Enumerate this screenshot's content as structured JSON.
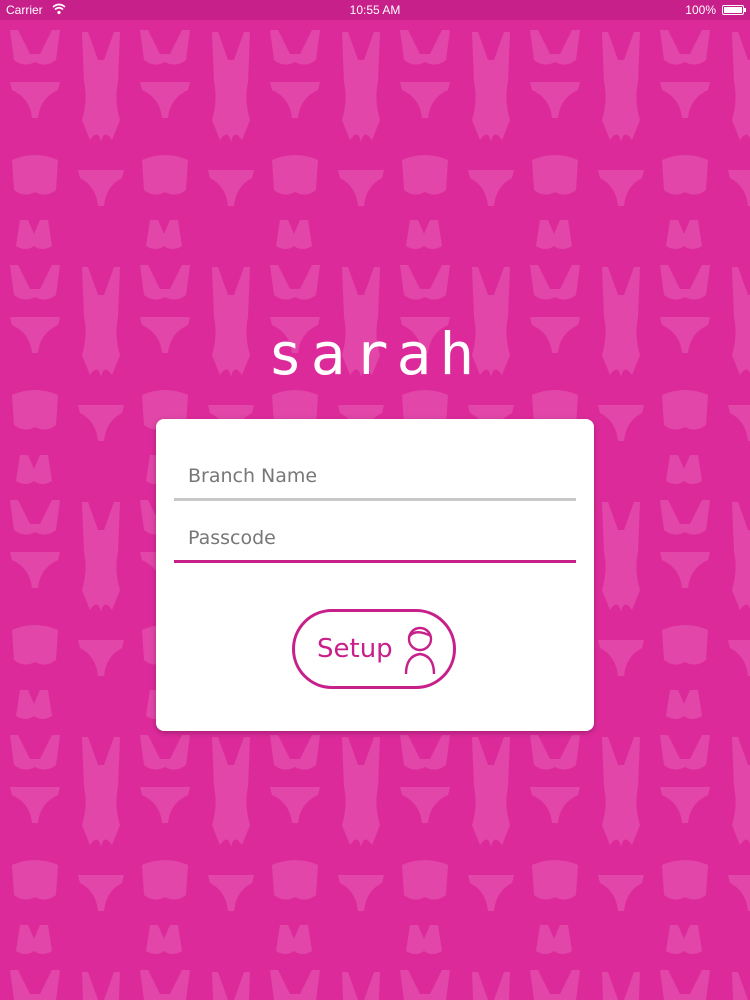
{
  "status_bar": {
    "carrier": "Carrier",
    "time": "10:55 AM",
    "battery": "100%"
  },
  "app": {
    "logo": "sarah"
  },
  "form": {
    "branch_name_placeholder": "Branch Name",
    "passcode_placeholder": "Passcode",
    "setup_label": "Setup"
  },
  "icons": {
    "wifi": "wifi-icon",
    "battery": "battery-icon",
    "setup": "person-icon"
  },
  "colors": {
    "background": "#dd2a9b",
    "accent": "#c8208a",
    "inactive_line": "#c8c8c8"
  }
}
